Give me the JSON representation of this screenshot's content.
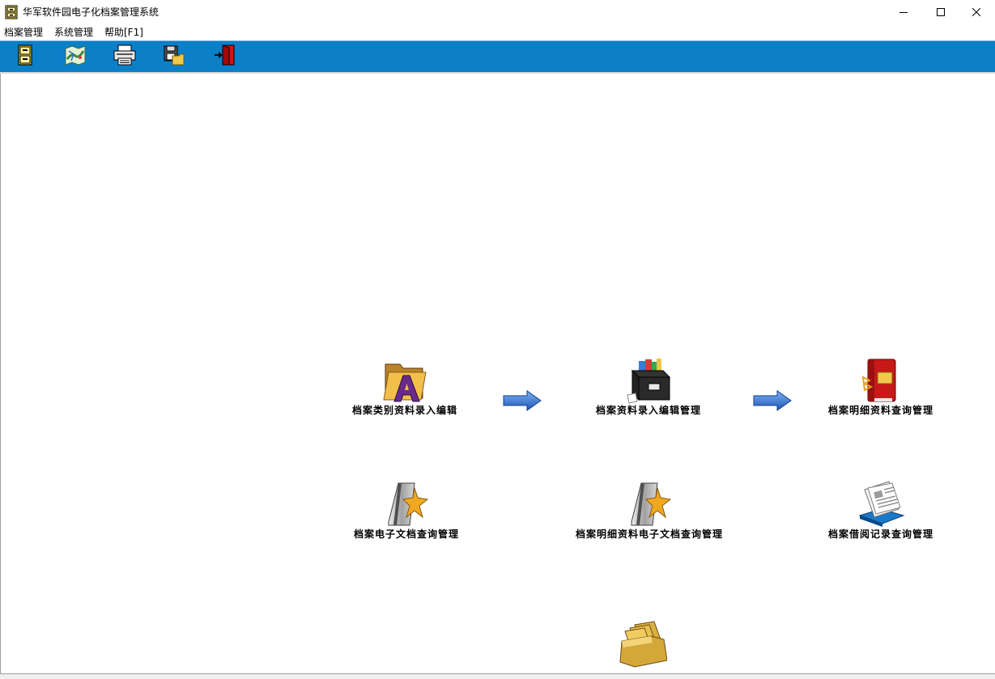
{
  "window": {
    "title": "华军软件园电子化档案管理系统",
    "icon": "archive-cabinet-icon",
    "controls": [
      "minimize-icon",
      "maximize-icon",
      "close-icon"
    ]
  },
  "menu": {
    "items": [
      "档案管理",
      "系统管理",
      "帮助[F1]"
    ]
  },
  "toolbar": {
    "background": "#0b7fc7",
    "buttons": [
      "archive-cabinet-icon",
      "map-icon",
      "printer-icon",
      "save-disk-icon",
      "exit-door-icon"
    ]
  },
  "modules": {
    "category_edit": {
      "label": "档案类别资料录入编辑",
      "icon": "folder-letter-a-icon"
    },
    "archive_edit": {
      "label": "档案资料录入编辑管理",
      "icon": "file-box-icon"
    },
    "detail_query": {
      "label": "档案明细资料查询管理",
      "icon": "red-binder-icon"
    },
    "edoc_query": {
      "label": "档案电子文档查询管理",
      "icon": "document-star-icon"
    },
    "detail_edoc_query": {
      "label": "档案明细资料电子文档查询管理",
      "icon": "document-star-icon"
    },
    "borrow_query": {
      "label": "档案借阅记录查询管理",
      "icon": "newspaper-stack-icon"
    },
    "folders": {
      "icon": "folder-stack-icon"
    }
  },
  "flow_arrows": [
    "arrow-right-icon",
    "arrow-right-icon"
  ]
}
